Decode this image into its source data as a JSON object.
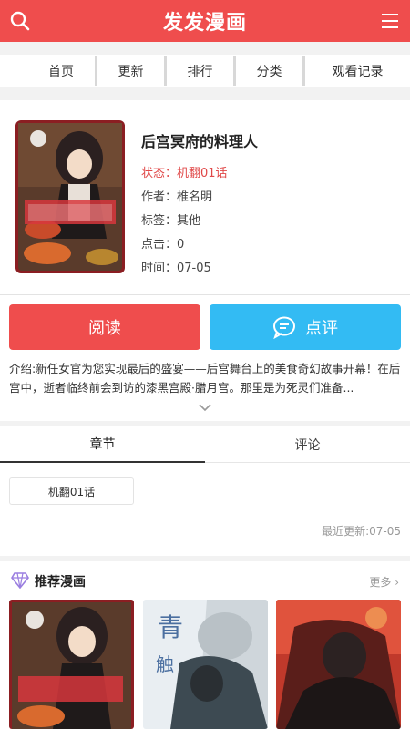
{
  "header": {
    "title": "发发漫画"
  },
  "nav": {
    "items": [
      "首页",
      "更新",
      "排行",
      "分类",
      "观看记录"
    ]
  },
  "comic": {
    "title": "后宫冥府的料理人",
    "status": "状态：机翻01话",
    "author": "作者：椎名明",
    "tags": "标签：其他",
    "clicks": "点击：0",
    "time": "时间：07-05"
  },
  "actions": {
    "read_label": "阅读",
    "comment_label": "点评"
  },
  "intro": "介绍:新任女官为您实现最后的盛宴——后宫舞台上的美食奇幻故事开幕！在后宫中，逝者临终前会到访的漆黑宫殿·腊月宫。那里是为死灵们准备...",
  "tabs": {
    "chapters": "章节",
    "comments": "评论"
  },
  "chapter_list": [
    "机翻01话"
  ],
  "last_update": "最近更新:07-05",
  "recommend": {
    "title": "推荐漫画",
    "more": "更多"
  },
  "colors": {
    "brand": "#ef4d4d",
    "comment_button": "#33bbf3"
  }
}
